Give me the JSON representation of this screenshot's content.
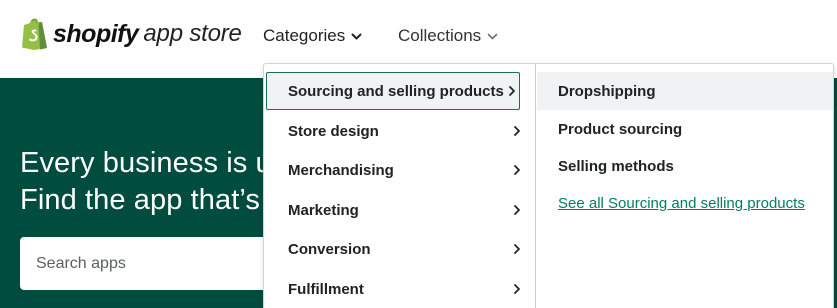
{
  "header": {
    "logo": {
      "wordmark": "shopify",
      "product": "app store",
      "icon": "shopify-bag-icon",
      "brand_color": "#95bf47"
    },
    "nav": [
      {
        "label": "Categories",
        "icon": "chevron-down-icon",
        "expanded": true
      },
      {
        "label": "Collections",
        "icon": "chevron-down-icon",
        "expanded": false
      }
    ]
  },
  "hero": {
    "background": "#004c3f",
    "line1": "Every business is u",
    "line2": "Find the app that’s",
    "search": {
      "placeholder": "Search apps",
      "value": ""
    }
  },
  "menu": {
    "categories": [
      {
        "label": "Sourcing and selling products",
        "icon": "chevron-right-icon",
        "active": true
      },
      {
        "label": "Store design",
        "icon": "chevron-right-icon",
        "active": false
      },
      {
        "label": "Merchandising",
        "icon": "chevron-right-icon",
        "active": false
      },
      {
        "label": "Marketing",
        "icon": "chevron-right-icon",
        "active": false
      },
      {
        "label": "Conversion",
        "icon": "chevron-right-icon",
        "active": false
      },
      {
        "label": "Fulfillment",
        "icon": "chevron-right-icon",
        "active": false
      }
    ],
    "subcategories": [
      {
        "label": "Dropshipping",
        "active": true
      },
      {
        "label": "Product sourcing",
        "active": false
      },
      {
        "label": "Selling methods",
        "active": false
      }
    ],
    "see_all_link": "See all Sourcing and selling products",
    "colors": {
      "active_border": "#1b6e5a",
      "hover_bg": "#f1f2f3",
      "link": "#007f5f"
    }
  }
}
